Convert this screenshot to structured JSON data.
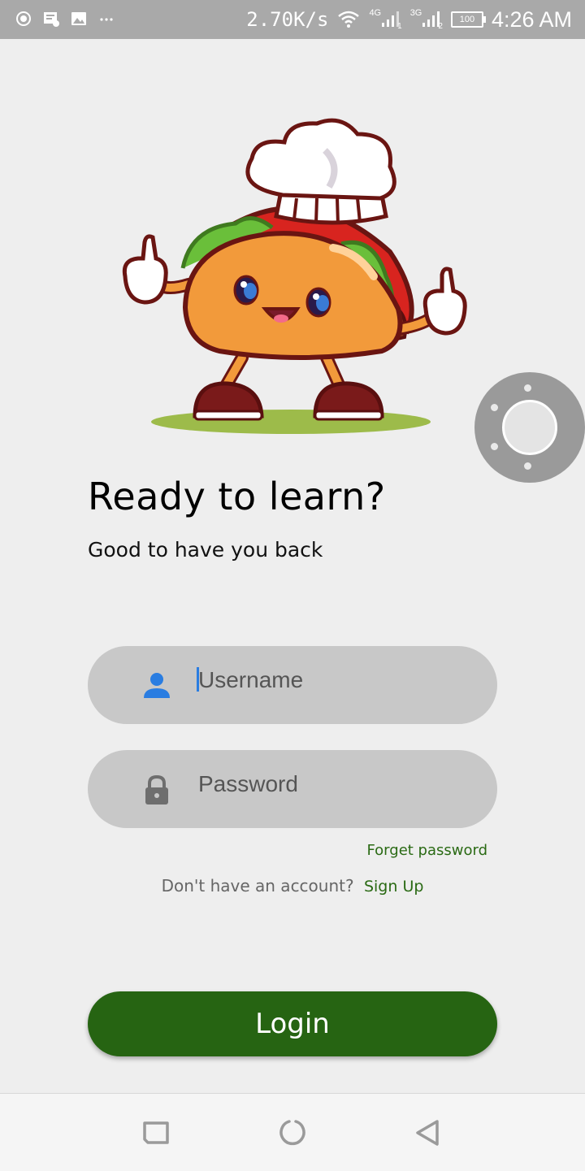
{
  "status_bar": {
    "net_speed": "2.70K/s",
    "signal_1_label": "4G",
    "signal_1_sub": "1",
    "signal_2_label": "3G",
    "signal_2_sub": "2",
    "battery": "100",
    "time": "4:26 AM"
  },
  "login": {
    "title": "Ready to learn?",
    "subtitle": "Good to have you back",
    "username_placeholder": "Username",
    "password_placeholder": "Password",
    "forgot_password": "Forget password",
    "no_account_text": "Don't have an account?",
    "signup_label": "Sign Up",
    "login_button": "Login"
  },
  "icons": {
    "user": "person-icon",
    "password": "lock-icon",
    "nav_recent": "square-icon",
    "nav_home": "circle-icon",
    "nav_back": "triangle-back-icon"
  },
  "colors": {
    "accent_green": "#266412",
    "link_green": "#2a6a14",
    "user_icon_blue": "#2a7de1",
    "field_bg": "#c8c8c8",
    "page_bg": "#eeeeee"
  }
}
